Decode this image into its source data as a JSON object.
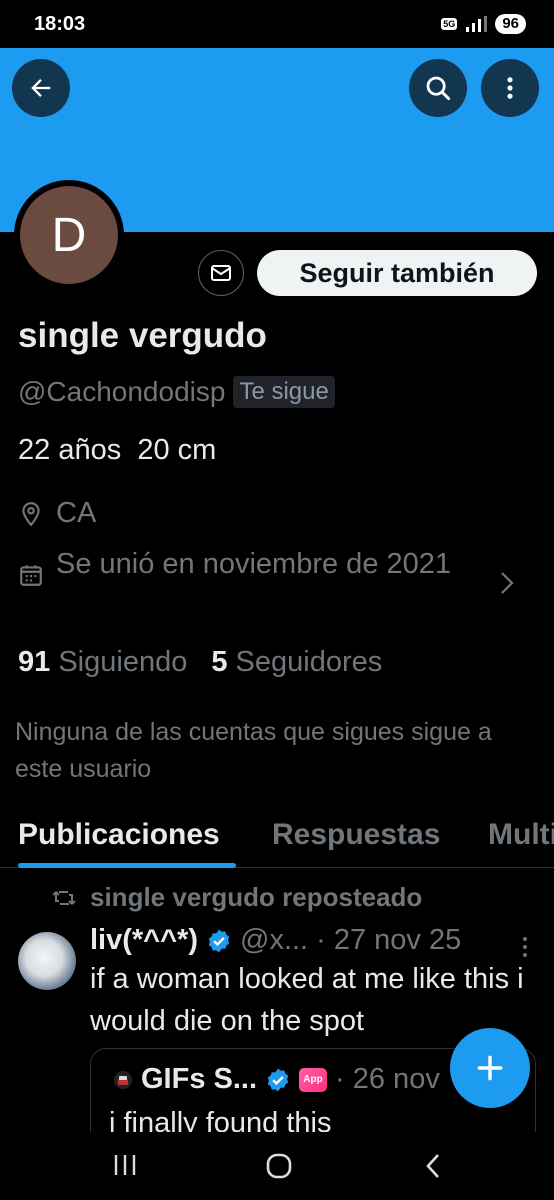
{
  "status_bar": {
    "time": "18:03",
    "network": "5G",
    "battery": "96"
  },
  "profile": {
    "avatar_letter": "D",
    "follow_label": "Seguir también",
    "name": "single vergudo",
    "handle": "@Cachondodisp",
    "follows_you": "Te sigue",
    "bio": "22 años  20 cm",
    "location": "CA",
    "joined": "Se unió en noviembre de 2021",
    "following_count": "91",
    "following_label": "Siguiendo",
    "followers_count": "5",
    "followers_label": "Seguidores",
    "mutual_note": "Ninguna de las cuentas que sigues sigue a este usuario"
  },
  "tabs": [
    {
      "label": "Publicaciones",
      "active": true
    },
    {
      "label": "Respuestas",
      "active": false
    },
    {
      "label": "Multi",
      "active": false
    }
  ],
  "post": {
    "repost_label": "single vergudo reposteado",
    "author": "liv(*^^*)",
    "handle": "@x...",
    "date": "· 27 nov 25",
    "text": "if a woman looked at me like this i would die on the spot",
    "quote": {
      "author": "GIFs S...",
      "app_badge": "App",
      "date": "· 26 nov",
      "text": "i finally found this"
    }
  },
  "colors": {
    "accent": "#1d9bf0",
    "background": "#000000",
    "muted": "#71767b"
  }
}
